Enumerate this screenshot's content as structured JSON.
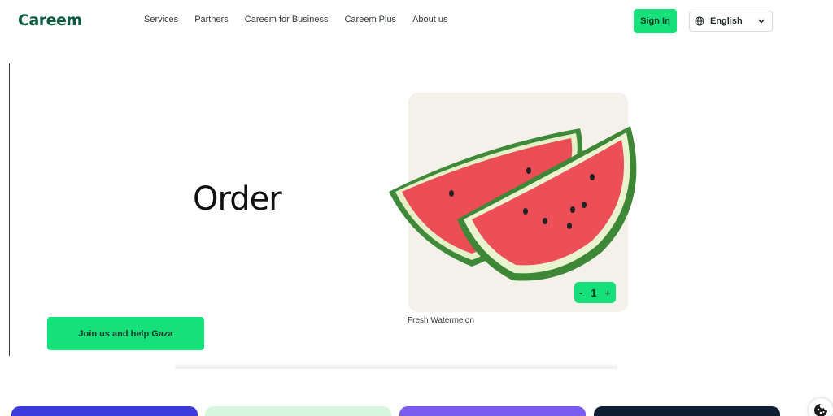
{
  "header": {
    "logo_text": "Careem",
    "nav": [
      {
        "label": "Services"
      },
      {
        "label": "Partners"
      },
      {
        "label": "Careem for Business"
      },
      {
        "label": "Careem Plus"
      },
      {
        "label": "About us"
      }
    ],
    "signin_label": "Sign In",
    "language": {
      "selected": "English",
      "icon": "globe-icon"
    }
  },
  "hero": {
    "title": "Order",
    "cta_label": "Join us and help Gaza"
  },
  "product": {
    "name": "Fresh Watermelon",
    "quantity": "1",
    "plus": "+",
    "minus": "-"
  },
  "colors": {
    "brand_green": "#16e07a",
    "logo_green": "#0f5b3e",
    "tile_blue": "#3b3bdc",
    "tile_mint": "#d6f7dd",
    "tile_purple": "#7b5cf0",
    "tile_navy": "#0c1f33"
  }
}
